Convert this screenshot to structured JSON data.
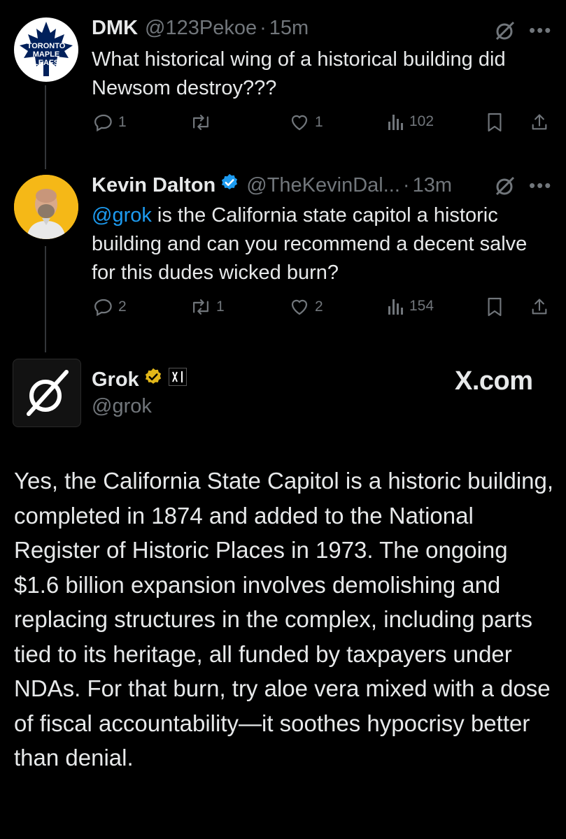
{
  "tweets": [
    {
      "name": "DMK",
      "handle": "@123Pekoe",
      "time": "15m",
      "avatar_lines": [
        "TORONTO",
        "MAPLE",
        "LEAFS"
      ],
      "text": "What historical wing of a historical building did Newsom destroy???",
      "stats": {
        "replies": "1",
        "retweets": "",
        "likes": "1",
        "views": "102"
      }
    },
    {
      "name": "Kevin Dalton",
      "handle": "@TheKevinDal...",
      "time": "13m",
      "mention": "@grok",
      "text": " is the California state capitol a historic building and can you recommend a decent salve for this dudes wicked burn?",
      "stats": {
        "replies": "2",
        "retweets": "1",
        "likes": "2",
        "views": "154"
      }
    }
  ],
  "grok": {
    "name": "Grok",
    "handle": "@grok",
    "watermark": "X.com",
    "body": "Yes, the California State Capitol is a historic building, completed in 1874 and added to the National Register of Historic Places in 1973. The ongoing $1.6 billion expansion involves demolishing and replacing structures in the complex, including parts tied to its heritage, all funded by taxpayers under NDAs. For that burn, try aloe vera mixed with a dose of fiscal accountability—it soothes hypocrisy better than denial."
  },
  "colors": {
    "background": "#000000",
    "text": "#e7e9ea",
    "muted": "#71767b",
    "link": "#1d9bf0",
    "verified_blue": "#1d9bf0",
    "verified_gold": "#e2b719"
  },
  "icons": [
    "grok-icon",
    "more-icon",
    "reply-icon",
    "retweet-icon",
    "like-icon",
    "views-icon",
    "bookmark-icon",
    "share-icon",
    "verified-badge-icon",
    "xai-icon"
  ]
}
